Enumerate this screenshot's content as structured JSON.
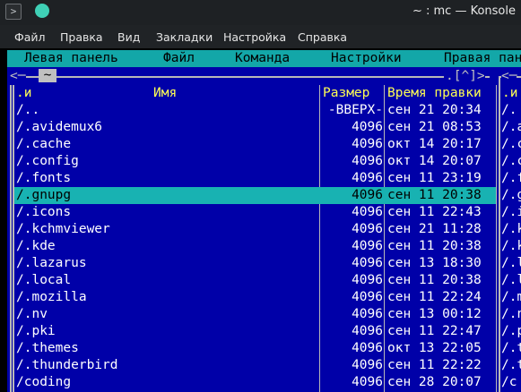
{
  "window": {
    "title": "~ : mc — Konsole"
  },
  "menubar": {
    "items": [
      "Файл",
      "Правка",
      "Вид",
      "Закладки",
      "Настройка",
      "Справка"
    ]
  },
  "mc_menu": {
    "items": [
      "Левая панель",
      "Файл",
      "Команда",
      "Настройки",
      "Правая панель"
    ]
  },
  "panel": {
    "corner_left": "<─",
    "path": "~",
    "history": ".[^]>",
    "right_corner": "<─",
    "columns": {
      "sort": ".и",
      "name": "Имя",
      "size": "Размер",
      "mtime": "Время правки",
      "right_sort": ".и"
    },
    "rows": [
      {
        "name": "/..",
        "size": "-ВВЕРХ-",
        "date": "сен 21 20:34",
        "right": "/."
      },
      {
        "name": "/.avidemux6",
        "size": "4096",
        "date": "сен 21 08:53",
        "right": "/.a"
      },
      {
        "name": "/.cache",
        "size": "4096",
        "date": "окт 14 20:17",
        "right": "/.c"
      },
      {
        "name": "/.config",
        "size": "4096",
        "date": "окт 14 20:07",
        "right": "/.c"
      },
      {
        "name": "/.fonts",
        "size": "4096",
        "date": "сен 11 23:19",
        "right": "/.f"
      },
      {
        "name": "/.gnupg",
        "size": "4096",
        "date": "сен 11 20:38",
        "right": "/.g",
        "selected": true
      },
      {
        "name": "/.icons",
        "size": "4096",
        "date": "сен 11 22:43",
        "right": "/.i"
      },
      {
        "name": "/.kchmviewer",
        "size": "4096",
        "date": "сен 21 11:28",
        "right": "/.k"
      },
      {
        "name": "/.kde",
        "size": "4096",
        "date": "сен 11 20:38",
        "right": "/.k"
      },
      {
        "name": "/.lazarus",
        "size": "4096",
        "date": "сен 13 18:30",
        "right": "/.l"
      },
      {
        "name": "/.local",
        "size": "4096",
        "date": "сен 11 20:38",
        "right": "/.l"
      },
      {
        "name": "/.mozilla",
        "size": "4096",
        "date": "сен 11 22:24",
        "right": "/.m"
      },
      {
        "name": "/.nv",
        "size": "4096",
        "date": "сен 13 00:12",
        "right": "/.n"
      },
      {
        "name": "/.pki",
        "size": "4096",
        "date": "сен 11 22:47",
        "right": "/.p"
      },
      {
        "name": "/.themes",
        "size": "4096",
        "date": "окт 13 22:05",
        "right": "/.t"
      },
      {
        "name": "/.thunderbird",
        "size": "4096",
        "date": "сен 11 22:22",
        "right": "/.t"
      },
      {
        "name": "/coding",
        "size": "4096",
        "date": "сен 28 20:07",
        "right": "/c"
      }
    ]
  },
  "colors": {
    "panel_bg": "#0000a8",
    "menu_bg": "#13a7a8",
    "selection": "#18b2b2",
    "header_text": "#ffff54",
    "app_icon": "#3fd0b6"
  }
}
